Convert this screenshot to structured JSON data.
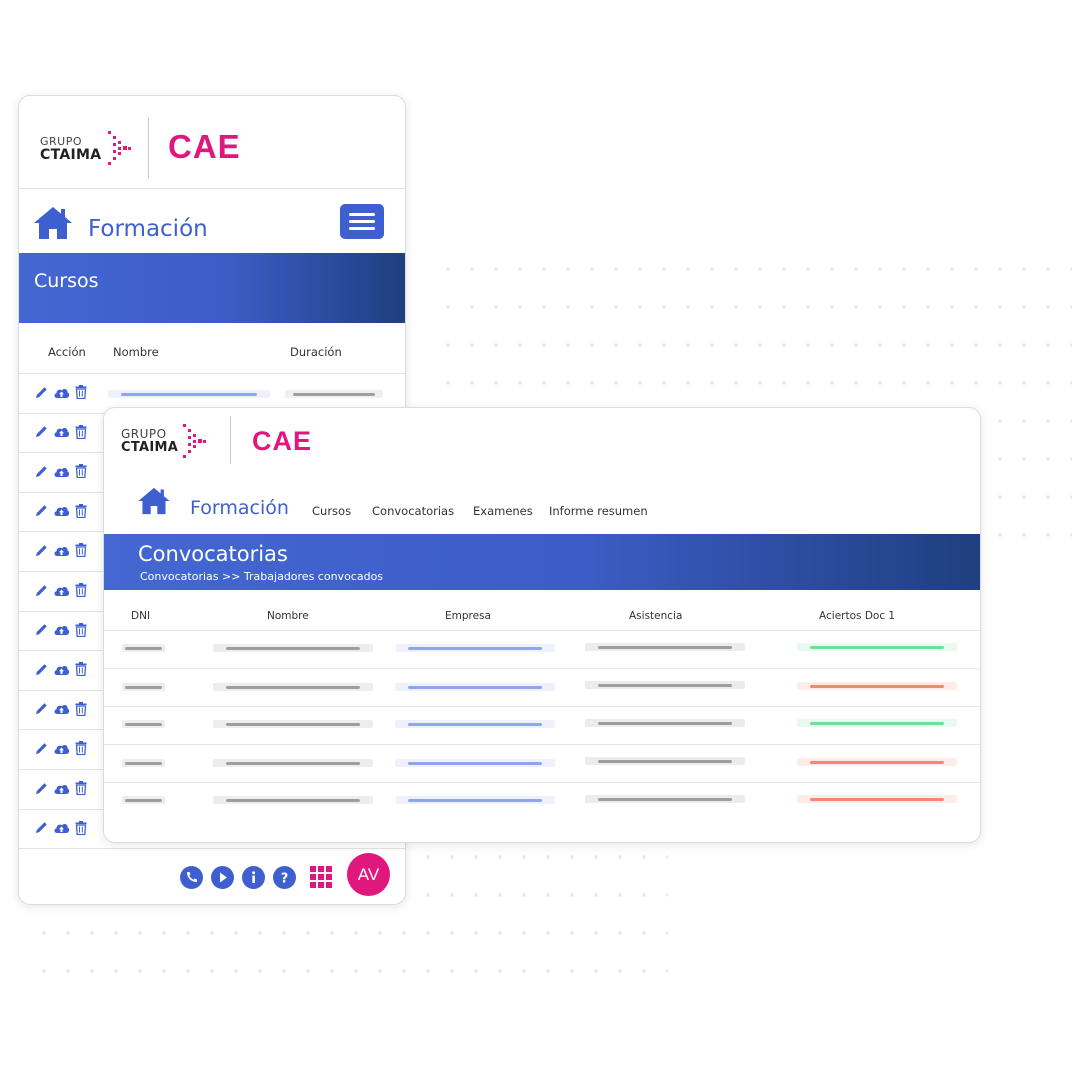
{
  "brand": {
    "grupo": "GRUPO",
    "ctaima": "CTAIMA",
    "product": "CAE"
  },
  "colors": {
    "accent_blue": "#3d5fcf",
    "brand_pink": "#e0177d",
    "band_gradient_end": "#1f3f7f",
    "bar_gray": "#9e9e9e",
    "bar_blue": "#8ea6ee",
    "bar_green": "#6fe09a",
    "bar_red": "#f2886e"
  },
  "mobile": {
    "title": "Formación",
    "menu_icon": "hamburger-icon",
    "section": "Cursos",
    "columns": [
      "Acción",
      "Nombre",
      "Duración"
    ],
    "action_icons": [
      "pencil-icon",
      "upload-cloud-icon",
      "trash-icon"
    ],
    "row_count": 12,
    "footer_icons": [
      "phone-icon",
      "play-icon",
      "info-icon",
      "help-icon",
      "apps-grid-icon"
    ],
    "avatar": "AV"
  },
  "desktop": {
    "title": "Formación",
    "nav": [
      "Cursos",
      "Convocatorias",
      "Examenes",
      "Informe resumen"
    ],
    "section": "Convocatorias",
    "breadcrumb": "Convocatorias >> Trabajadores convocados",
    "columns": [
      "DNI",
      "Nombre",
      "Empresa",
      "Asistencia",
      "Aciertos Doc 1"
    ],
    "aciertos_status": [
      "green",
      "red",
      "green",
      "red",
      "red"
    ]
  }
}
